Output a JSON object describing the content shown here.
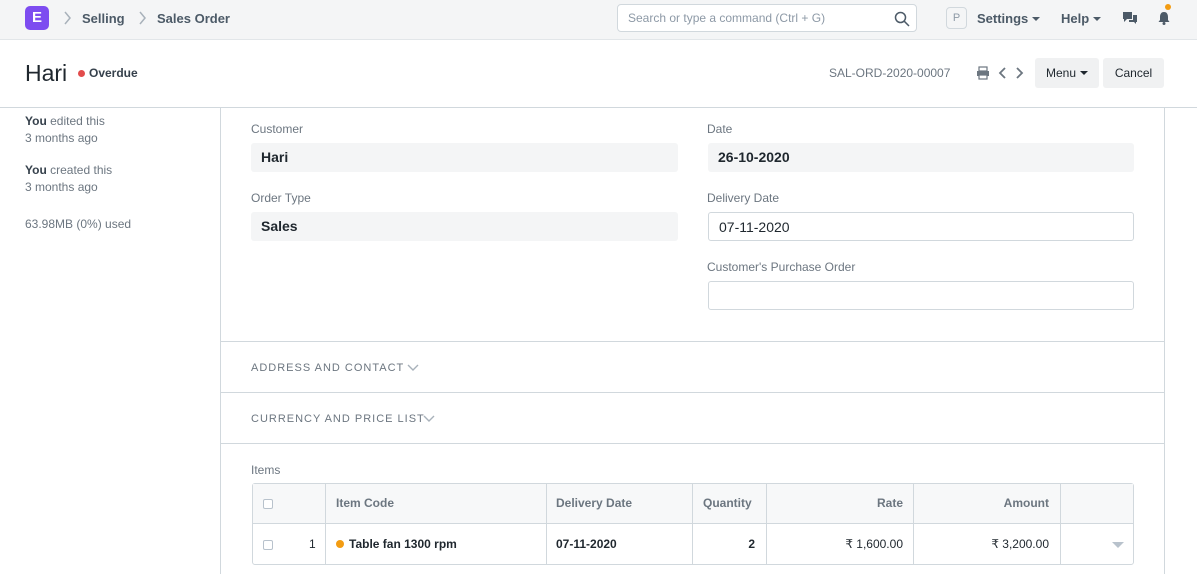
{
  "navbar": {
    "logo_letter": "E",
    "breadcrumbs": [
      "Selling",
      "Sales Order"
    ],
    "search_placeholder": "Search or type a command (Ctrl + G)",
    "avatar_letter": "P",
    "settings_label": "Settings",
    "help_label": "Help",
    "icons": [
      "search-icon",
      "chat-icon",
      "bell-icon"
    ],
    "notification_color": "#f39c12"
  },
  "header": {
    "title": "Hari",
    "status": "Overdue",
    "status_color": "#e24c4c",
    "doc_name": "SAL-ORD-2020-00007",
    "menu_label": "Menu",
    "cancel_label": "Cancel"
  },
  "sidebar": {
    "edited_actor": "You",
    "edited_text": "edited this",
    "edited_time": "3 months ago",
    "created_actor": "You",
    "created_text": "created this",
    "created_time": "3 months ago",
    "storage": "63.98MB (0%) used"
  },
  "form": {
    "customer_label": "Customer",
    "customer_value": "Hari",
    "date_label": "Date",
    "date_value": "26-10-2020",
    "order_type_label": "Order Type",
    "order_type_value": "Sales",
    "delivery_date_label": "Delivery Date",
    "delivery_date_value": "07-11-2020",
    "po_label": "Customer's Purchase Order",
    "po_value": "",
    "sections": [
      "ADDRESS AND CONTACT",
      "CURRENCY AND PRICE LIST"
    ],
    "items_label": "Items"
  },
  "items_table": {
    "columns": [
      "Item Code",
      "Delivery Date",
      "Quantity",
      "Rate",
      "Amount"
    ],
    "rows": [
      {
        "idx": "1",
        "item_code": "Table fan 1300 rpm",
        "delivery_date": "07-11-2020",
        "quantity": "2",
        "rate": "₹ 1,600.00",
        "amount": "₹ 3,200.00"
      }
    ]
  }
}
